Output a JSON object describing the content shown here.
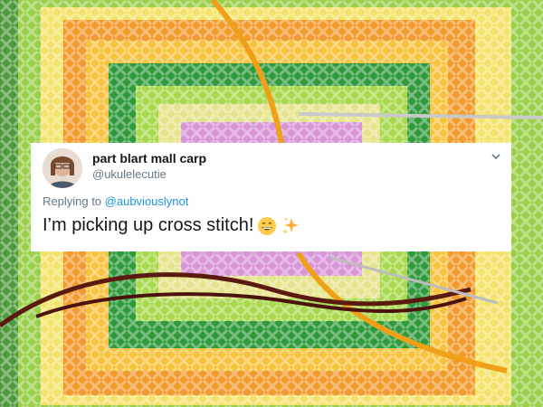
{
  "tweet": {
    "display_name": "part blart mall carp",
    "handle": "@ukulelecutie",
    "reply_prefix": "Replying to",
    "reply_to": "@aubviouslynot",
    "text": "I’m picking up cross stitch!",
    "emojis": [
      "grinning-face-icon",
      "sparkles-icon"
    ]
  },
  "colors": {
    "link": "#1b95e0",
    "secondary_text": "#657786",
    "primary_text": "#14171a"
  }
}
